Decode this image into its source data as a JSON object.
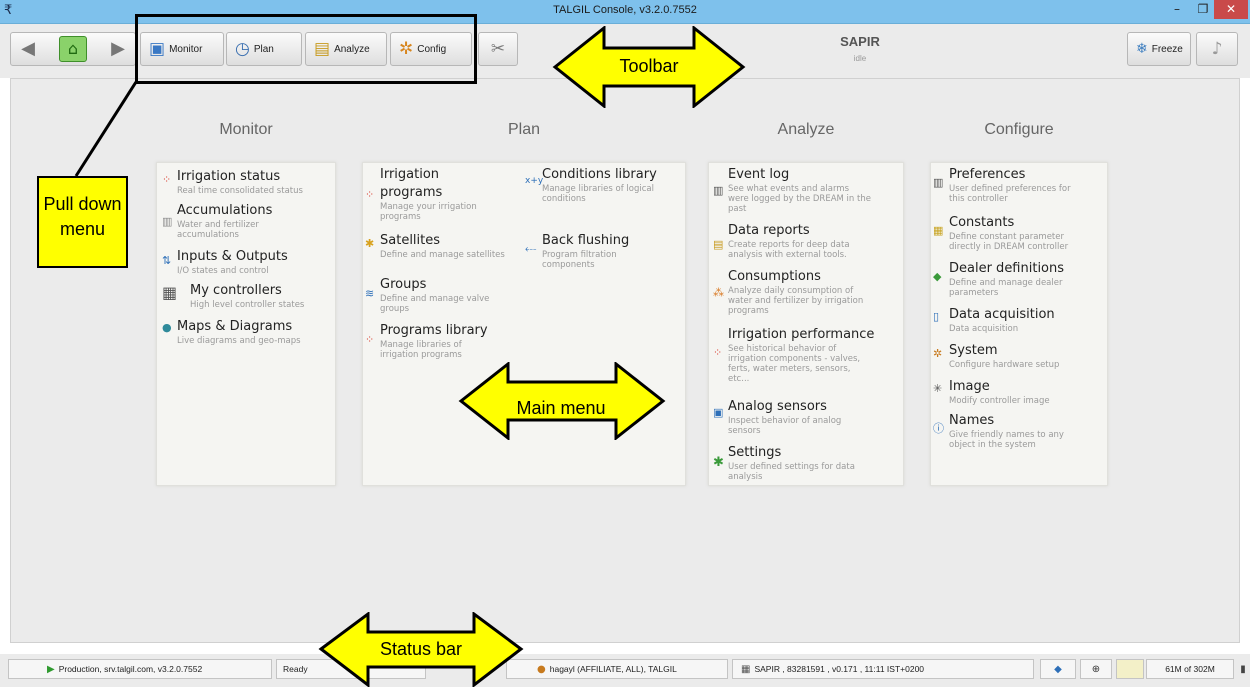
{
  "window": {
    "title": "TALGIL Console, v3.2.0.7552",
    "min_glyph": "–",
    "max_glyph": "❐",
    "close_glyph": "✕"
  },
  "toolbar": {
    "monitor_label": "Monitor",
    "plan_label": "Plan",
    "analyze_label": "Analyze",
    "config_label": "Config",
    "freeze_label": "Freeze",
    "controller_name": "SAPIR",
    "controller_state": "idle"
  },
  "annotations": {
    "toolbar": "Toolbar",
    "pulldown_line1": "Pull down",
    "pulldown_line2": "menu",
    "main_menu": "Main menu",
    "status_bar": "Status bar"
  },
  "columns": {
    "monitor": "Monitor",
    "plan": "Plan",
    "analyze": "Analyze",
    "configure": "Configure"
  },
  "monitor_items": [
    {
      "title": "Irrigation status",
      "desc": [
        "Real time consolidated status"
      ]
    },
    {
      "title": "Accumulations",
      "desc": [
        "Water and fertilizer",
        "accumulations"
      ]
    },
    {
      "title": "Inputs & Outputs",
      "desc": [
        "I/O states and control"
      ]
    },
    {
      "title": "My controllers",
      "desc": [
        "High level controller states"
      ]
    },
    {
      "title": "Maps & Diagrams",
      "desc": [
        "Live diagrams and geo-maps"
      ]
    }
  ],
  "plan_items": [
    {
      "title": [
        "Irrigation",
        "programs"
      ],
      "desc": [
        "Manage your irrigation",
        "programs"
      ]
    },
    {
      "title": "Satellites",
      "desc": [
        "Define and manage satellites"
      ]
    },
    {
      "title": "Groups",
      "desc": [
        "Define and manage valve",
        "groups"
      ]
    },
    {
      "title": "Programs library",
      "desc": [
        "Manage libraries of",
        "irrigation programs"
      ]
    },
    {
      "title": "Conditions library",
      "desc": [
        "Manage libraries of logical",
        "conditions"
      ]
    },
    {
      "title": "Back flushing",
      "desc": [
        "Program filtration",
        "components"
      ]
    }
  ],
  "analyze_items": [
    {
      "title": "Event log",
      "desc": [
        "See what events and alarms",
        "were logged by the DREAM in the",
        "past"
      ]
    },
    {
      "title": "Data reports",
      "desc": [
        "Create reports for deep data",
        "analysis with external tools."
      ]
    },
    {
      "title": "Consumptions",
      "desc": [
        "Analyze daily consumption of",
        "water and fertilizer by irrigation",
        "programs"
      ]
    },
    {
      "title": "Irrigation performance",
      "desc": [
        "See historical behavior of",
        "irrigation components - valves,",
        "ferts, water meters, sensors,",
        "etc..."
      ]
    },
    {
      "title": "Analog sensors",
      "desc": [
        "Inspect behavior of analog",
        "sensors"
      ]
    },
    {
      "title": "Settings",
      "desc": [
        "User defined settings for data",
        "analysis"
      ]
    }
  ],
  "configure_items": [
    {
      "title": "Preferences",
      "desc": [
        "User defined preferences for",
        "this controller"
      ]
    },
    {
      "title": "Constants",
      "desc": [
        "Define constant parameter",
        "directly in DREAM controller"
      ]
    },
    {
      "title": "Dealer definitions",
      "desc": [
        "Define and manage dealer",
        "parameters"
      ]
    },
    {
      "title": "Data acquisition",
      "desc": [
        "Data acquisition"
      ]
    },
    {
      "title": "System",
      "desc": [
        "Configure hardware setup"
      ]
    },
    {
      "title": "Image",
      "desc": [
        "Modify controller image"
      ]
    },
    {
      "title": "Names",
      "desc": [
        "Give friendly names to any",
        "object in the system"
      ]
    }
  ],
  "statusbar": {
    "server": "Production, srv.talgil.com, v3.2.0.7552",
    "state": "Ready",
    "user": "hagayl (AFFILIATE, ALL), TALGIL",
    "controller": "SAPIR , 83281591 , v0.171 , 11:11 IST+0200",
    "memory": "61M of 302M"
  }
}
